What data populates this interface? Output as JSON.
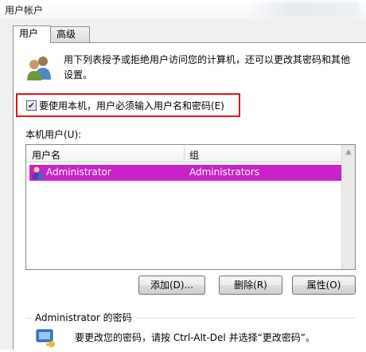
{
  "window": {
    "title": "用户帐户"
  },
  "tabs": [
    {
      "label": "用户",
      "active": true
    },
    {
      "label": "高级",
      "active": false
    }
  ],
  "intro": {
    "icon": "users-icon",
    "text": "用下列表授予或拒绝用户访问您的计算机，还可以更改其密码和其他设置。"
  },
  "require_login": {
    "label": "要使用本机，用户必须输入用户名和密码(E)",
    "checked": true,
    "highlight_color": "#e0161b"
  },
  "local_users": {
    "label": "本机用户(U):",
    "columns": [
      "用户名",
      "组"
    ],
    "rows": [
      {
        "icon": "user-icon",
        "username": "Administrator",
        "group": "Administrators",
        "selected": true
      }
    ],
    "selection_color": "#c822c8"
  },
  "buttons": {
    "add": "添加(D)...",
    "delete": "删除(R)",
    "properties": "属性(O)"
  },
  "password_group": {
    "title": "Administrator 的密码",
    "icon": "key-icon",
    "text": "要更改您的密码，请按 Ctrl-Alt-Del 并选择“更改密码”。"
  }
}
